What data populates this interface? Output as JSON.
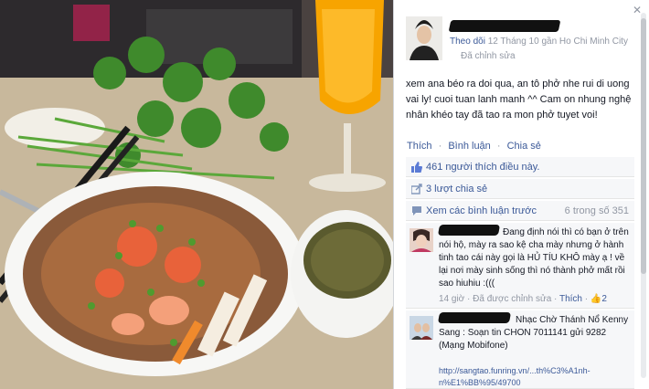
{
  "post": {
    "follow_label": "Theo dõi",
    "date_text": "12 Tháng 10 gần Ho Chi Minh City",
    "edited_label": "Đã chỉnh sửa",
    "body": "xem ana béo ra doi qua, an tô phở nhe rui di uong vai ly! cuoi tuan lanh manh ^^ Cam on nhung nghệ nhân khéo tay đã tao ra mon phở tuyet voi!"
  },
  "actions": {
    "like": "Thích",
    "comment": "Bình luận",
    "share": "Chia sẻ",
    "sep": "·"
  },
  "ufi": {
    "likes_count": "461",
    "likes_text": "người thích điều này.",
    "shares_text": "3 lượt chia sẻ",
    "prev_comments": "Xem các bình luận trước",
    "prev_counter": "6 trong số 351"
  },
  "comments": [
    {
      "body": "Đang định nói thì có bạn ở trên nói hộ, mày ra sao kệ cha mày nhưng ở hành tinh tao cái này gọi là HỦ TÍU KHÔ mày ạ ! về lại nơi mày sinh sống thì nó thành phở mất rồi sao hiuhiu :(((",
      "time": "14 giờ",
      "edited": "Đã được chỉnh sửa",
      "like": "Thích",
      "likes": "2",
      "sep": "·"
    },
    {
      "body": "Nhạc Chờ Thánh Nổ Kenny Sang : Soạn tin CHON 7011141 gửi 9282 (Mạng Mobifone)",
      "link1": "http://sangtao.funring.vn/...th%C3%A1nh-",
      "link2": "n%E1%BB%95/49700"
    }
  ],
  "icons": {
    "close": "close-icon",
    "like": "thumbs-up-icon",
    "share": "share-icon",
    "comment": "speech-bubble-icon"
  },
  "colors": {
    "link": "#3b5998",
    "meta": "#9197a3",
    "ufi_bg": "#f6f7f9"
  }
}
